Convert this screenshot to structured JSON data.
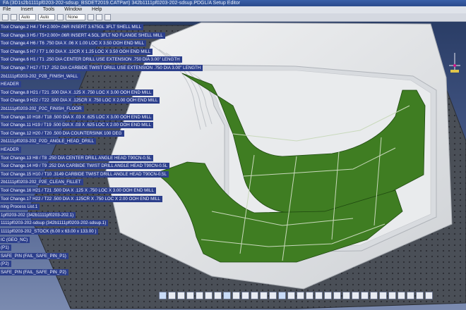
{
  "window": {
    "title": "FA (3D1s2b1111pf0203-202-sdsup_BSDET2019.CATPart) 342b1111pf0203-202-sdsup.PDGL/A Setup Editor"
  },
  "menu": {
    "items": [
      "File",
      "Insert",
      "Tools",
      "Window",
      "Help"
    ]
  },
  "toolbar": {
    "combo1": "Auto",
    "combo2": "Auto",
    "combo3": "None"
  },
  "tree": {
    "items": [
      "Tool Change.2   H4 / T4+2.000+.06R INSERT 3.675GL 3FLT SHELL MILL",
      "Tool Change.3   H5 / T5+2.000+.06R INSERT 4.5GL 3FLT NO FLANGE SHELL MILL",
      "Tool Change.4   H6 / T6 .750 DIA X .06 X 1.00 LOC X 3.50 OOH END MILL",
      "Tool Change.5   H7 / T7 1.00 DIA X .12CR X 1.25 LOC X 3.50 OOH END MILL",
      "Tool Change.6   H1 / T1 .250 DIA CENTER DRILL USE EXTENSION .750 DIA 3.00\" LENGTH",
      "Tool Change.7   H17 / T17 .252 DIA CARBIDE TWIST DRILL USE EXTENSION .750 DIA 3.00\" LENGTH",
      "2b1111pf0203-202_P2B_FINISH_WALL",
      "HEADER",
      "Tool Change.8   H21 / T21 .500 DIA X .125 X .750 LOC X 3.00 OOH END MILL",
      "Tool Change.9   H22 / T22 .500 DIA X .125CR X .750 LOC X 2.00 OOH END MILL",
      "2b1111pf0203-202_P2C_FINISH_FLOOR",
      "Tool Change.10   H18 / T18 .500 DIA X .03 X .625 LOC X 3.00 OOH END MILL",
      "Tool Change.11   H19 / T19 .500 DIA X .03 X .625 LOC X 2.00 OOH END MILL",
      "Tool Change.12   H20 / T20 .500 DIA COUNTERSINK 100 DEG",
      "2b1111pf0203-202_P2D_ANGLE_HEAD_DRILL",
      "HEADER",
      "Tool Change.13   H8 / T8 .250 DIA CENTER DRILL ANGLE HEAD T90CN-0.5L",
      "Tool Change.14   H9 / T9 .252 DIA CARBIDE TWIST DRILL ANGLE HEAD T90CN-0.5L",
      "Tool Change.15   H10 / T10 .3149 CARBIDE TWIST DRILL ANGLE HEAD T90CN-0.5L",
      "2b1111pf0203-202_P2E_CLEAN_FILLET",
      "Tool Change.16   H21 / T21 .500 DIA X .125 X .750 LOC X 3.00 OOH END MILL",
      "Tool Change.17   H22 / T22 .500 DIA X .125CR X .750 LOC X 2.00 OOH END MILL",
      "ning Process List.1",
      "1pf0203-202 (342b1111pf0203-202.1)",
      "1111pf0203-202-sdsup (342b1111pf0203-202-sdsup.1)",
      "1111pf0203-202_STOCK (6.00 x 63.00 x 133.00 )",
      "IC (GEO_NC)",
      "(P1)",
      "SAFE_PIN (FAIL_SAFE_PIN_P1)",
      "(P2)",
      "SAFE_PIN (FAIL_SAFE_PIN_P2)"
    ]
  },
  "colors": {
    "fixture": "#4a4f57",
    "stock": "#e6e8ea",
    "part": "#3f7d22",
    "tree_bg": "#2c3f8c"
  },
  "icons": [
    "compass-icon"
  ]
}
